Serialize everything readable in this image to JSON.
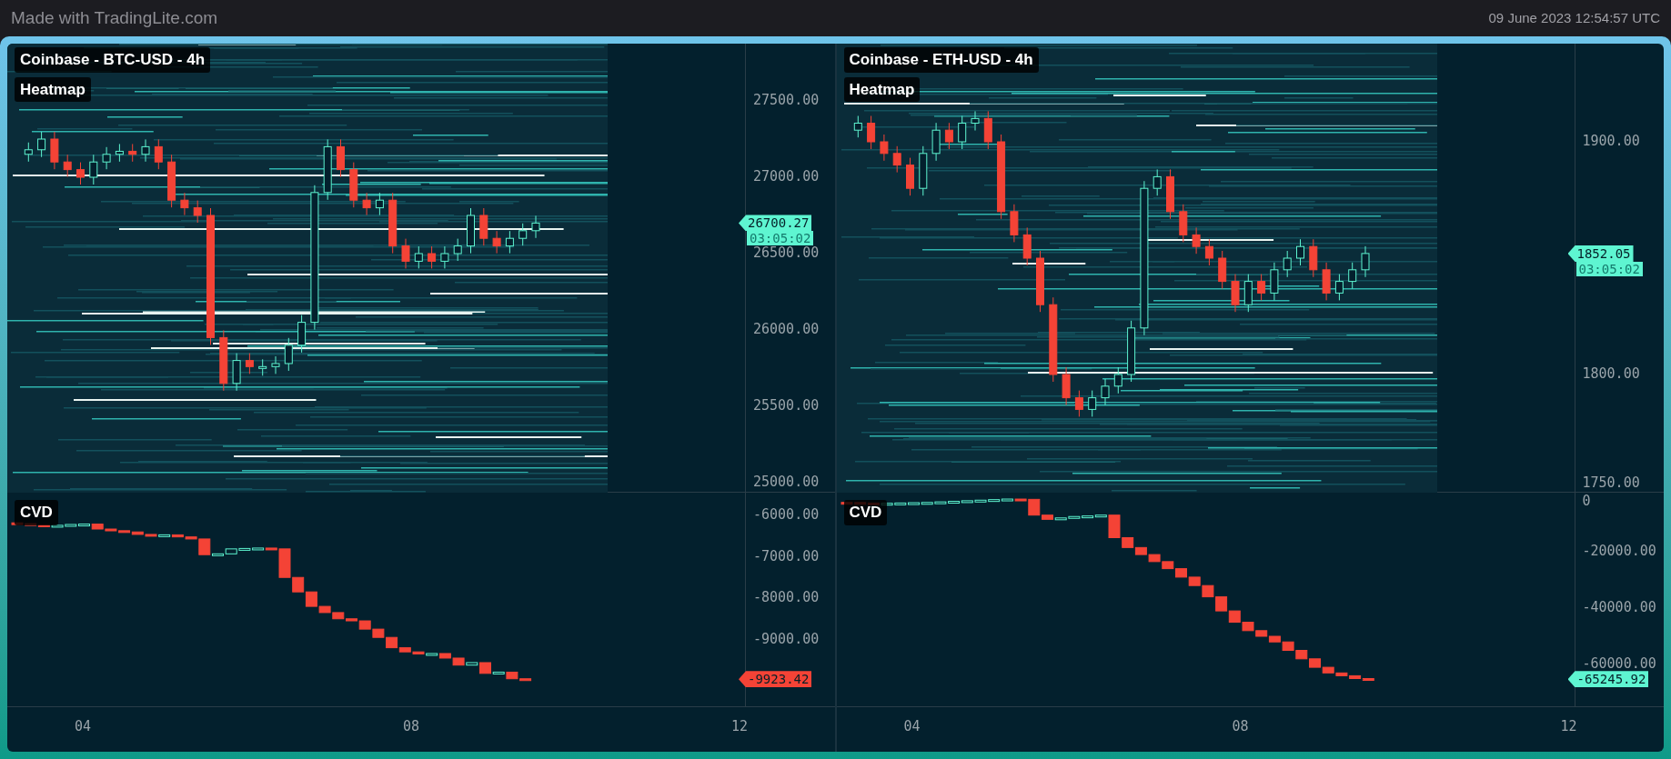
{
  "top_bar": {
    "brand": "Made with TradingLite.com",
    "timestamp": "09 June 2023 12:54:57 UTC"
  },
  "panels": [
    {
      "title": "Coinbase - BTC-USD - 4h",
      "overlay_label": "Heatmap",
      "price_ticks": [
        "27500.00",
        "27000.00",
        "26500.00",
        "26000.00",
        "25500.00",
        "25000.00"
      ],
      "price_badge": {
        "text": "26700.27",
        "color": "#5ef5d1"
      },
      "countdown": "03:05:02",
      "cvd_label": "CVD",
      "cvd_ticks": [
        "-6000.00",
        "-7000.00",
        "-8000.00",
        "-9000.00"
      ],
      "cvd_badge": {
        "text": "-9923.42",
        "color": "#f44336"
      },
      "time_ticks": [
        "04",
        "08",
        "12"
      ]
    },
    {
      "title": "Coinbase - ETH-USD - 4h",
      "overlay_label": "Heatmap",
      "price_ticks": [
        "1900.00",
        "1800.00",
        "1750.00"
      ],
      "price_badge": {
        "text": "1852.05",
        "color": "#5ef5d1"
      },
      "countdown": "03:05:02",
      "cvd_label": "CVD",
      "cvd_ticks": [
        "0",
        "-20000.00",
        "-40000.00",
        "-60000.00"
      ],
      "cvd_badge": {
        "text": "-65245.92",
        "color": "#5ef5d1"
      },
      "time_ticks": [
        "04",
        "08",
        "12"
      ]
    }
  ]
}
